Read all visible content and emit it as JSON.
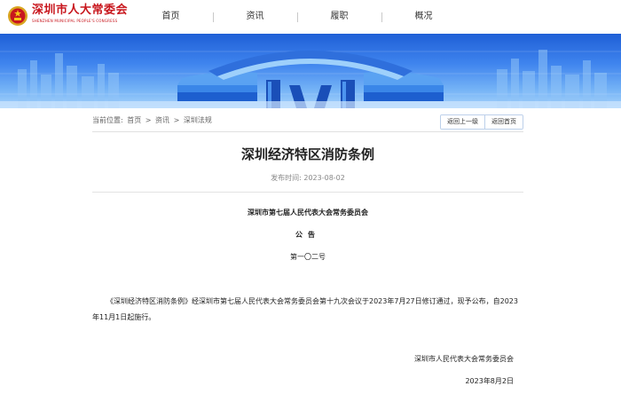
{
  "header": {
    "site_name": "深圳市人大常委会",
    "site_name_en": "SHENZHEN MUNICIPAL PEOPLE'S CONGRESS",
    "logo_icon": "national-emblem-icon",
    "nav": [
      {
        "label": "首页"
      },
      {
        "label": "资讯"
      },
      {
        "label": "履职"
      },
      {
        "label": "概况"
      }
    ]
  },
  "breadcrumb": {
    "prefix": "当前位置:",
    "items": [
      "首页",
      "资讯",
      "深圳法规"
    ],
    "separator": ">"
  },
  "buttons": {
    "back": "返回上一级",
    "home": "返回首页"
  },
  "article": {
    "title": "深圳经济特区消防条例",
    "publish_date": "发布时间: 2023-08-02",
    "issuer": "深圳市第七届人民代表大会常务委员会",
    "notice": "公告",
    "doc_number": "第一〇二号",
    "body": "《深圳经济特区消防条例》经深圳市第七届人民代表大会常务委员会第十九次会议于2023年7月27日修订通过，现予公布，自2023年11月1日起施行。",
    "sign_org": "深圳市人民代表大会常务委员会",
    "sign_date": "2023年8月2日"
  },
  "colors": {
    "brand": "#c8161d",
    "banner_top": "#1f5fd6",
    "banner_bottom": "#a7d3fb"
  }
}
